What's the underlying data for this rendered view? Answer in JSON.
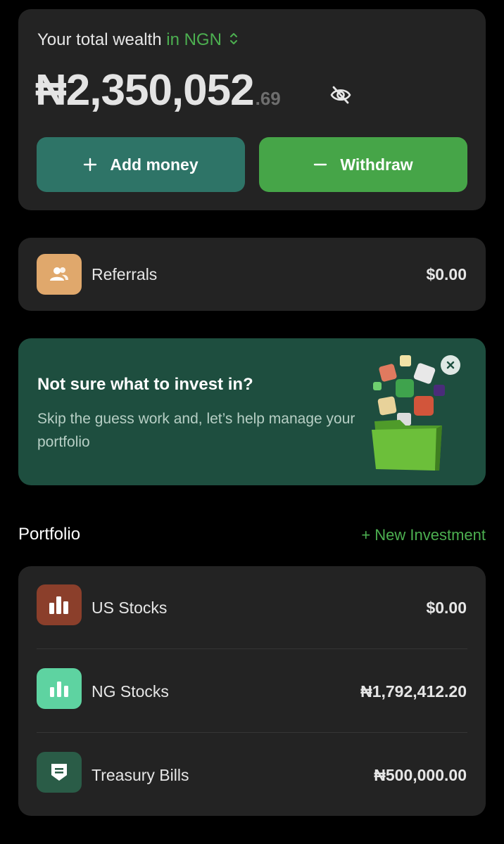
{
  "wealth": {
    "title_prefix": "Your total wealth",
    "currency_label": "in NGN",
    "amount_main": "₦2,350,052",
    "amount_decimal": ".69",
    "add_money_label": "Add money",
    "withdraw_label": "Withdraw"
  },
  "referrals": {
    "label": "Referrals",
    "value": "$0.00"
  },
  "promo": {
    "title": "Not sure what to invest in?",
    "description": "Skip the guess work and, let’s help manage your portfolio"
  },
  "portfolio": {
    "title": "Portfolio",
    "new_investment_label": "+ New Investment",
    "items": [
      {
        "label": "US Stocks",
        "value": "$0.00",
        "icon": "us-stocks-chart-icon",
        "color": "#8b3f2b"
      },
      {
        "label": "NG Stocks",
        "value": "₦1,792,412.20",
        "icon": "ng-stocks-chart-icon",
        "color": "#5ed3a1"
      },
      {
        "label": "Treasury Bills",
        "value": "₦500,000.00",
        "icon": "treasury-shield-icon",
        "color": "#2a5c47"
      }
    ]
  },
  "colors": {
    "accent_green": "#46a548",
    "teal_button": "#2e7467",
    "promo_bg": "#1e4e3f",
    "card_bg": "#232323",
    "referral_icon_bg": "#e0a86c"
  }
}
